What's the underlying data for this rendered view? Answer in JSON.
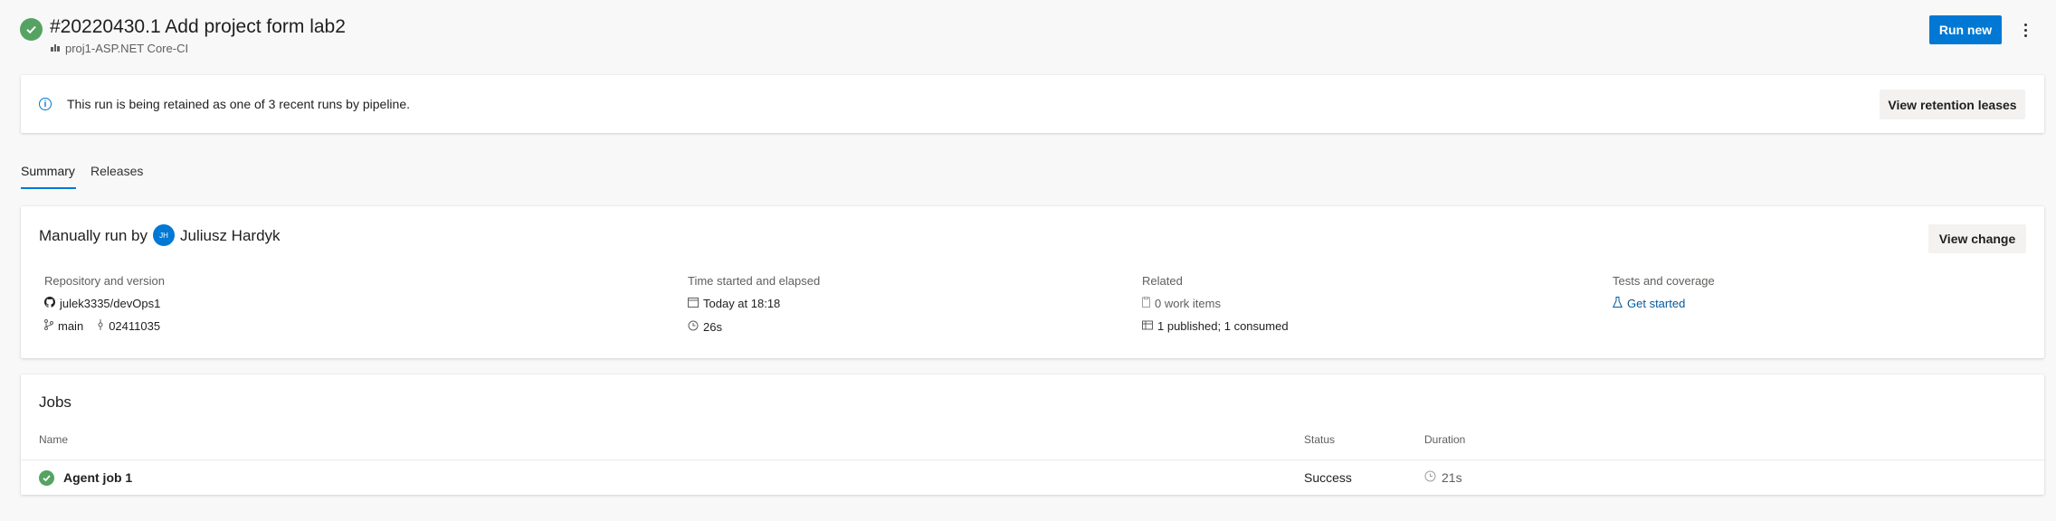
{
  "header": {
    "title": "#20220430.1 Add project form lab2",
    "pipeline_name": "proj1-ASP.NET Core-CI",
    "run_new_label": "Run new"
  },
  "banner": {
    "message": "This run is being retained as one of 3 recent runs by pipeline.",
    "button_label": "View retention leases"
  },
  "tabs": [
    {
      "label": "Summary",
      "selected": true
    },
    {
      "label": "Releases",
      "selected": false
    }
  ],
  "summary": {
    "run_by_prefix": "Manually run by",
    "user_initials": "JH",
    "user_name": "Juliusz Hardyk",
    "view_change_label": "View change",
    "repository": {
      "label": "Repository and version",
      "repo": "julek3335/devOps1",
      "branch": "main",
      "commit": "02411035"
    },
    "time": {
      "label": "Time started and elapsed",
      "started": "Today at 18:18",
      "elapsed": "26s"
    },
    "related": {
      "label": "Related",
      "work_items": "0 work items",
      "artifacts": "1 published; 1 consumed"
    },
    "tests": {
      "label": "Tests and coverage",
      "link": "Get started"
    }
  },
  "jobs": {
    "title": "Jobs",
    "columns": [
      "Name",
      "Status",
      "Duration"
    ],
    "rows": [
      {
        "name": "Agent job 1",
        "status": "Success",
        "duration": "21s"
      }
    ]
  },
  "colors": {
    "accent": "#0078d4",
    "success": "#55a362",
    "link": "#005a9e"
  }
}
